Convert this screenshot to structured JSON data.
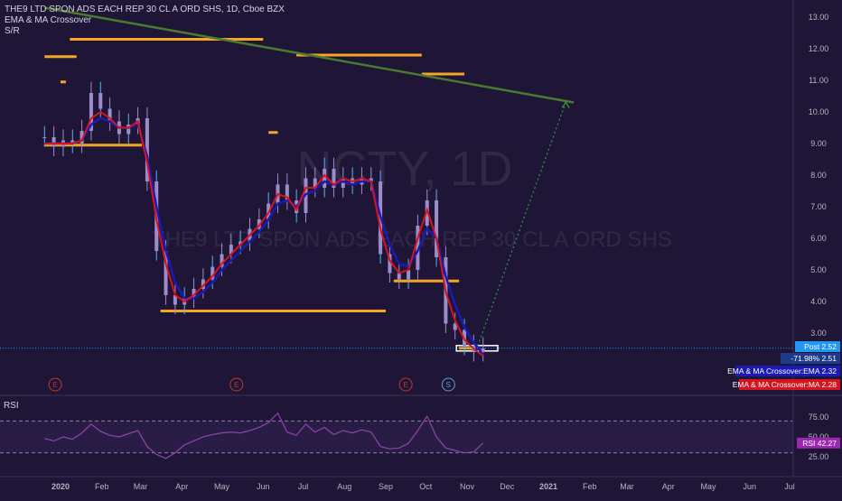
{
  "header": {
    "symbol_line": "THE9 LTD SPON ADS EACH REP 30 CL A ORD SHS, 1D, Cboe BZX",
    "indicator_1": "EMA & MA Crossover",
    "indicator_2": "S/R"
  },
  "watermark": {
    "ticker": "NCTY, 1D",
    "name": "THE9 LTD SPON ADS EACH REP 30 CL A ORD SHS"
  },
  "price_axis": {
    "ticks": [
      "13.00",
      "12.00",
      "11.00",
      "10.00",
      "9.00",
      "8.00",
      "7.00",
      "6.00",
      "5.00",
      "4.00",
      "3.00"
    ]
  },
  "time_axis": {
    "labels": [
      "2020",
      "Feb",
      "Mar",
      "Apr",
      "May",
      "Jun",
      "Jul",
      "Aug",
      "Sep",
      "Oct",
      "Nov",
      "Dec",
      "2021",
      "Feb",
      "Mar",
      "Apr",
      "May",
      "Jun",
      "Jul"
    ]
  },
  "badges": {
    "post_label": "Post",
    "post_value": "2.52",
    "change_pct": "-71.98%",
    "change_value": "2.51",
    "ema_label": "EMA & MA Crossover:EMA",
    "ema_value": "2.32",
    "ma_label": "EMA & MA Crossover:MA",
    "ma_value": "2.28",
    "rsi_label": "RSI",
    "rsi_value": "42.27"
  },
  "event_markers": [
    {
      "label": "E"
    },
    {
      "label": "E"
    },
    {
      "label": "E"
    },
    {
      "label": "S"
    }
  ],
  "rsi_pane": {
    "title": "RSI",
    "ticks": [
      "75.00",
      "50.00",
      "25.00"
    ],
    "upper_band": 70,
    "lower_band": 30
  },
  "colors": {
    "background": "#1f1637",
    "candle": "#9c8cc9",
    "candle_light": "#5ab4f0",
    "ema": "#1a1ab4",
    "ma": "#d4141e",
    "sr": "#f5a623",
    "trendline": "#4a7a2a",
    "projection": "#2e9e3e",
    "rsi_line": "#8e44ad",
    "post_badge": "#2196f3",
    "rsi_badge": "#9c27b0"
  },
  "chart_data": {
    "type": "line",
    "title": "THE9 LTD SPON ADS EACH REP 30 CL A ORD SHS, 1D, Cboe BZX",
    "ylim": [
      3.0,
      13.0
    ],
    "price_series": {
      "name": "NCTY",
      "dates": [
        "2019-12-20",
        "2019-12-27",
        "2020-01-03",
        "2020-01-10",
        "2020-01-17",
        "2020-01-24",
        "2020-01-31",
        "2020-02-07",
        "2020-02-14",
        "2020-02-21",
        "2020-02-28",
        "2020-03-06",
        "2020-03-13",
        "2020-03-20",
        "2020-03-27",
        "2020-04-03",
        "2020-04-10",
        "2020-04-17",
        "2020-04-24",
        "2020-05-01",
        "2020-05-08",
        "2020-05-15",
        "2020-05-22",
        "2020-05-29",
        "2020-06-05",
        "2020-06-12",
        "2020-06-19",
        "2020-06-26",
        "2020-07-03",
        "2020-07-10",
        "2020-07-17",
        "2020-07-24",
        "2020-07-31",
        "2020-08-07",
        "2020-08-14",
        "2020-08-21",
        "2020-08-28",
        "2020-09-04",
        "2020-09-11",
        "2020-09-18",
        "2020-09-25",
        "2020-10-02",
        "2020-10-09",
        "2020-10-16",
        "2020-10-23",
        "2020-10-30",
        "2020-11-06",
        "2020-11-13"
      ],
      "values": [
        9.2,
        8.9,
        9.1,
        9.0,
        9.4,
        10.6,
        10.1,
        9.7,
        9.3,
        9.6,
        9.8,
        7.8,
        5.6,
        4.2,
        3.9,
        4.1,
        4.4,
        4.7,
        5.1,
        5.5,
        5.8,
        5.9,
        6.3,
        6.6,
        7.1,
        7.7,
        7.2,
        6.8,
        7.9,
        7.6,
        8.2,
        7.6,
        7.9,
        7.7,
        7.9,
        7.8,
        5.5,
        4.9,
        4.7,
        5.0,
        6.4,
        7.2,
        5.4,
        3.3,
        3.1,
        2.6,
        2.4,
        2.52
      ]
    },
    "ema_series": {
      "name": "EMA",
      "values": [
        9.0,
        9.0,
        9.0,
        9.0,
        9.1,
        9.6,
        9.8,
        9.7,
        9.5,
        9.5,
        9.6,
        8.6,
        7.0,
        5.6,
        4.6,
        4.1,
        4.1,
        4.3,
        4.6,
        5.0,
        5.3,
        5.6,
        5.9,
        6.2,
        6.6,
        7.1,
        7.2,
        7.0,
        7.4,
        7.5,
        7.8,
        7.7,
        7.8,
        7.7,
        7.8,
        7.8,
        6.7,
        5.8,
        5.2,
        5.1,
        5.6,
        6.3,
        6.0,
        4.8,
        3.9,
        3.2,
        2.7,
        2.32
      ]
    },
    "ma_series": {
      "name": "MA",
      "values": [
        9.0,
        9.0,
        9.0,
        9.0,
        9.1,
        9.8,
        10.0,
        9.8,
        9.5,
        9.5,
        9.7,
        8.4,
        6.6,
        5.2,
        4.2,
        4.0,
        4.2,
        4.5,
        4.8,
        5.2,
        5.5,
        5.8,
        6.1,
        6.4,
        6.8,
        7.4,
        7.3,
        6.9,
        7.6,
        7.6,
        8.0,
        7.7,
        7.9,
        7.8,
        7.9,
        7.8,
        6.3,
        5.3,
        4.9,
        5.0,
        6.0,
        6.9,
        6.0,
        4.3,
        3.4,
        2.8,
        2.5,
        2.28
      ]
    },
    "sr_levels": [
      {
        "from": "2019-12-20",
        "to": "2020-01-13",
        "price": 11.75
      },
      {
        "from": "2020-01-01",
        "to": "2020-01-05",
        "price": 10.95
      },
      {
        "from": "2020-01-08",
        "to": "2020-06-01",
        "price": 12.3
      },
      {
        "from": "2019-12-20",
        "to": "2020-03-02",
        "price": 8.95
      },
      {
        "from": "2020-03-16",
        "to": "2020-09-01",
        "price": 3.7
      },
      {
        "from": "2020-06-05",
        "to": "2020-06-12",
        "price": 9.35
      },
      {
        "from": "2020-06-26",
        "to": "2020-09-28",
        "price": 11.8
      },
      {
        "from": "2020-09-28",
        "to": "2020-10-30",
        "price": 11.2
      },
      {
        "from": "2020-09-07",
        "to": "2020-10-26",
        "price": 4.65
      },
      {
        "from": "2020-10-26",
        "to": "2020-11-06",
        "price": 2.52
      }
    ],
    "trendline": {
      "from": [
        "2019-12-20",
        13.3
      ],
      "to": [
        "2021-01-20",
        10.3
      ]
    },
    "projection": {
      "from": [
        "2020-11-09",
        2.6
      ],
      "to": [
        "2021-01-14",
        10.3
      ]
    },
    "rsi": {
      "name": "RSI",
      "ylim": [
        15,
        85
      ],
      "values": [
        48,
        45,
        50,
        47,
        55,
        66,
        57,
        52,
        50,
        54,
        58,
        38,
        28,
        23,
        30,
        40,
        45,
        50,
        53,
        55,
        56,
        55,
        58,
        62,
        68,
        80,
        56,
        52,
        66,
        56,
        62,
        53,
        58,
        55,
        59,
        56,
        38,
        35,
        36,
        42,
        58,
        76,
        50,
        36,
        33,
        30,
        31,
        42.27
      ]
    }
  }
}
